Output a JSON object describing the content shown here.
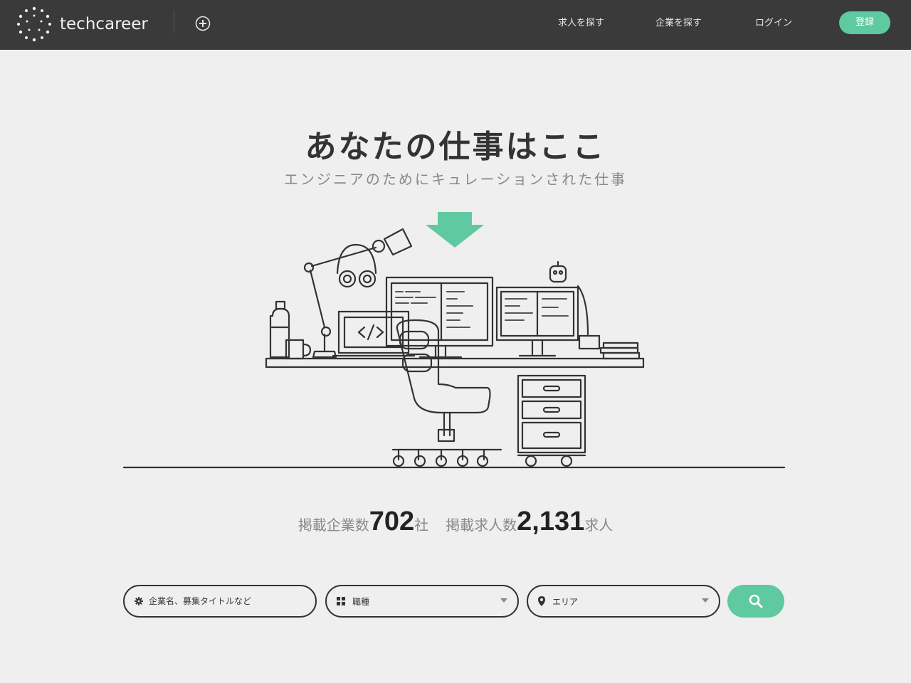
{
  "header": {
    "brand": "techcareer",
    "nav": {
      "search_jobs": "求人を探す",
      "search_companies": "企業を探す",
      "login": "ログイン",
      "register": "登録"
    }
  },
  "hero": {
    "title": "あなたの仕事はここ",
    "subtitle": "エンジニアのためにキュレーションされた仕事"
  },
  "stats": {
    "companies_label": "掲載企業数",
    "companies_count": "702",
    "companies_unit": "社",
    "jobs_label": "掲載求人数",
    "jobs_count": "2,131",
    "jobs_unit": "求人"
  },
  "search": {
    "keyword_placeholder": "企業名、募集タイトルなど",
    "job_type_label": "職種",
    "area_label": "エリア"
  },
  "colors": {
    "header_bg": "#3a3a3a",
    "accent": "#5fc9a1",
    "page_bg": "#efefef"
  },
  "icons": {
    "logo": "dotted-circle-logo",
    "plus": "plus-circle-icon",
    "keyword": "gear-icon",
    "job_type": "grid-icon",
    "area": "location-pin-icon",
    "search": "search-icon",
    "arrow": "down-arrow-icon"
  }
}
